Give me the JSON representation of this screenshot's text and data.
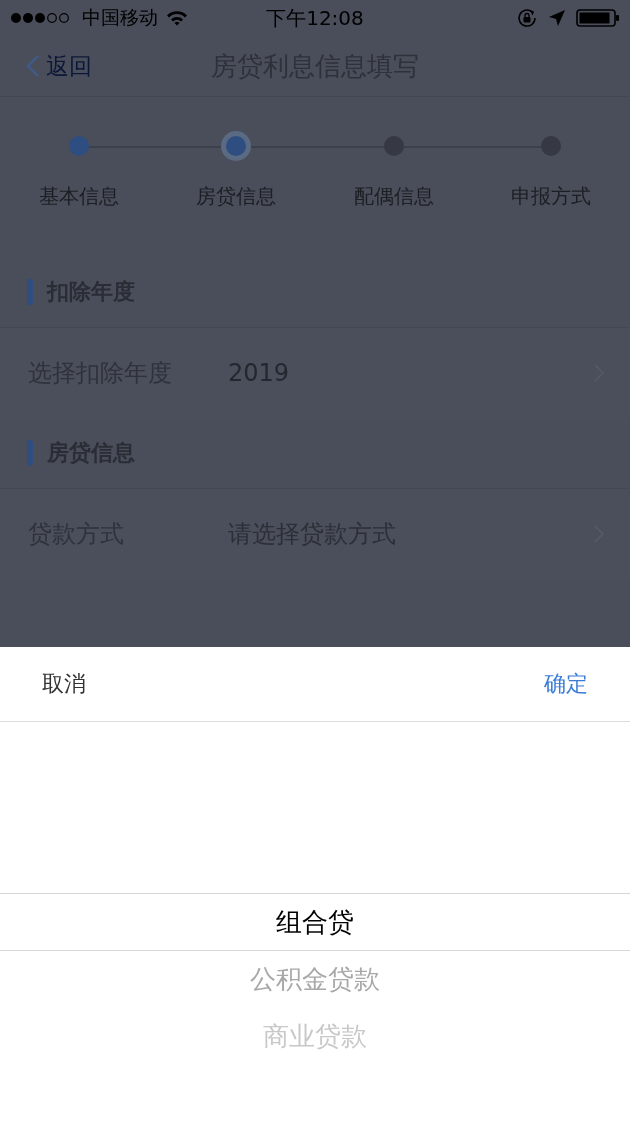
{
  "status_bar": {
    "carrier": "中国移动",
    "time": "下午12:08"
  },
  "nav": {
    "back": "返回",
    "title": "房贷利息信息填写"
  },
  "steps": [
    {
      "label": "基本信息",
      "done": true,
      "current": false
    },
    {
      "label": "房贷信息",
      "done": true,
      "current": true
    },
    {
      "label": "配偶信息",
      "done": false,
      "current": false
    },
    {
      "label": "申报方式",
      "done": false,
      "current": false
    }
  ],
  "sections": [
    {
      "title": "扣除年度",
      "rows": [
        {
          "label": "选择扣除年度",
          "value": "2019"
        }
      ]
    },
    {
      "title": "房贷信息",
      "rows": [
        {
          "label": "贷款方式",
          "placeholder": "请选择贷款方式"
        }
      ]
    }
  ],
  "sheet": {
    "cancel": "取消",
    "confirm": "确定",
    "options": [
      {
        "label": "组合贷",
        "selected": true
      },
      {
        "label": "公积金贷款",
        "selected": false
      },
      {
        "label": "商业贷款",
        "selected": false
      }
    ]
  }
}
